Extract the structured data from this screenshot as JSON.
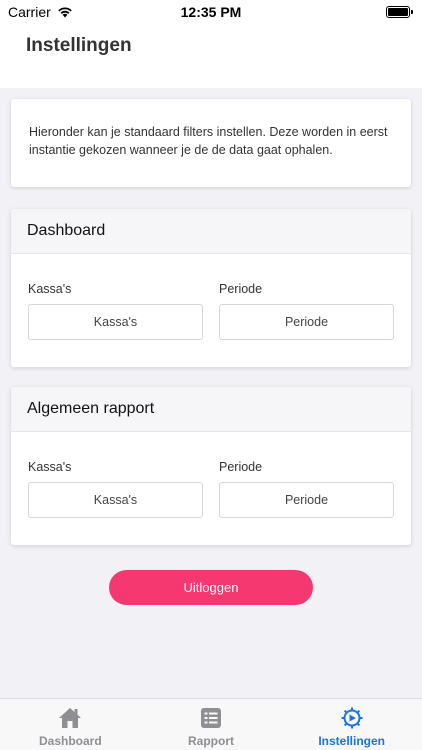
{
  "status_bar": {
    "carrier": "Carrier",
    "time": "12:35 PM",
    "battery_level": 1.0
  },
  "header": {
    "title": "Instellingen"
  },
  "intro": {
    "text": "Hieronder kan je standaard filters instellen. Deze worden in eerst instantie gekozen wanneer je de de data gaat ophalen."
  },
  "sections": [
    {
      "title": "Dashboard",
      "kassas_label": "Kassa's",
      "kassas_value": "Kassa's",
      "periode_label": "Periode",
      "periode_value": "Periode"
    },
    {
      "title": "Algemeen rapport",
      "kassas_label": "Kassa's",
      "kassas_value": "Kassa's",
      "periode_label": "Periode",
      "periode_value": "Periode"
    }
  ],
  "logout_label": "Uitloggen",
  "tabs": [
    {
      "label": "Dashboard",
      "icon": "home-icon",
      "active": false
    },
    {
      "label": "Rapport",
      "icon": "list-icon",
      "active": false
    },
    {
      "label": "Instellingen",
      "icon": "settings-gear-icon",
      "active": true
    }
  ],
  "colors": {
    "accent": "#f5386f",
    "active_tab": "#1a73e8",
    "inactive_tab": "#8e8e93",
    "background": "#f2f2f6"
  }
}
